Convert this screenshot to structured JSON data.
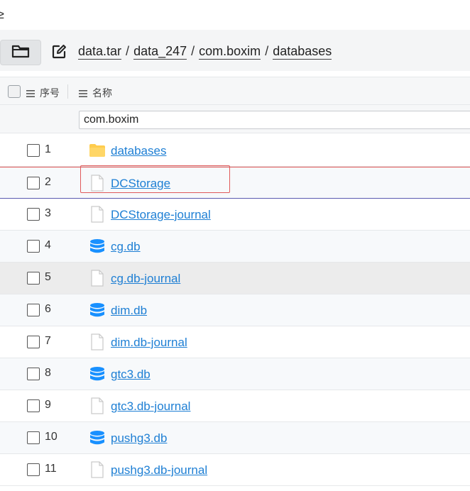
{
  "top_fragment": "≥",
  "breadcrumb": {
    "items": [
      "data.tar",
      "data_247",
      "com.boxim",
      "databases"
    ],
    "separator": "/"
  },
  "header": {
    "seq_label": "序号",
    "name_label": "名称"
  },
  "filter": {
    "value": "com.boxim"
  },
  "files": [
    {
      "num": "1",
      "name": "databases",
      "icon": "folder-icon"
    },
    {
      "num": "2",
      "name": "DCStorage",
      "icon": "file-icon"
    },
    {
      "num": "3",
      "name": "DCStorage-journal",
      "icon": "file-icon"
    },
    {
      "num": "4",
      "name": "cg.db",
      "icon": "database-icon"
    },
    {
      "num": "5",
      "name": "cg.db-journal",
      "icon": "file-icon"
    },
    {
      "num": "6",
      "name": "dim.db",
      "icon": "database-icon"
    },
    {
      "num": "7",
      "name": "dim.db-journal",
      "icon": "file-icon"
    },
    {
      "num": "8",
      "name": "gtc3.db",
      "icon": "database-icon"
    },
    {
      "num": "9",
      "name": "gtc3.db-journal",
      "icon": "file-icon"
    },
    {
      "num": "10",
      "name": "pushg3.db",
      "icon": "database-icon"
    },
    {
      "num": "11",
      "name": "pushg3.db-journal",
      "icon": "file-icon"
    }
  ],
  "colors": {
    "link": "#1e7fd4",
    "folder": "#ffcc4d",
    "database": "#1890ff",
    "highlight": "#e05a5a"
  }
}
